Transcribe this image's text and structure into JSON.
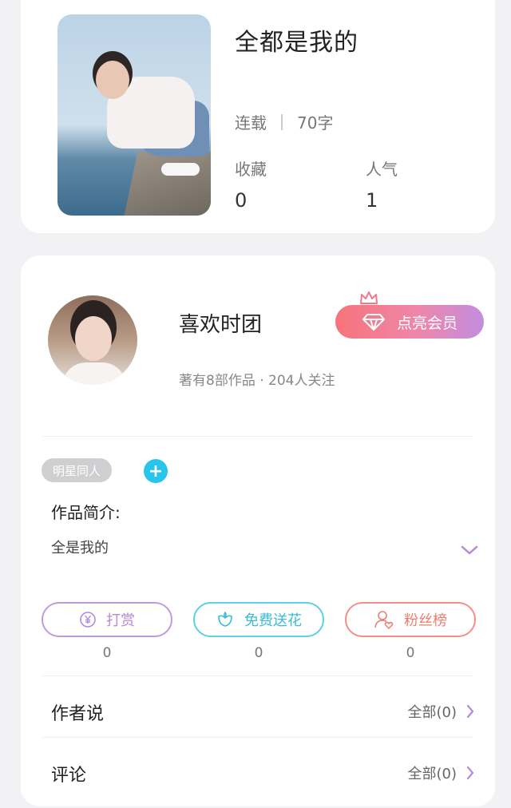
{
  "book": {
    "title": "全都是我的",
    "status": "连载",
    "word_count": "70字",
    "favorites_label": "收藏",
    "favorites_value": "0",
    "popularity_label": "人气",
    "popularity_value": "1"
  },
  "author": {
    "name": "喜欢时团",
    "meta": "著有8部作品 · 204人关注",
    "vip_button": "点亮会员"
  },
  "work": {
    "tag": "明星同人",
    "add_tag_symbol": "+",
    "intro_label": "作品简介:",
    "intro_text": "全是我的"
  },
  "actions": [
    {
      "label": "打赏",
      "count": "0",
      "icon": "yen-coin-icon"
    },
    {
      "label": "免费送花",
      "count": "0",
      "icon": "flower-icon"
    },
    {
      "label": "粉丝榜",
      "count": "0",
      "icon": "fan-user-icon"
    }
  ],
  "sections": {
    "author_says_label": "作者说",
    "author_says_link": "全部(0)",
    "comments_label": "评论",
    "comments_link": "全部(0)"
  },
  "colors": {
    "accent_purple": "#b58ad8",
    "accent_cyan": "#3bbbd8",
    "accent_coral": "#ee7d72",
    "vip_gradient_start": "#f7737a",
    "vip_gradient_end": "#c38de0"
  }
}
